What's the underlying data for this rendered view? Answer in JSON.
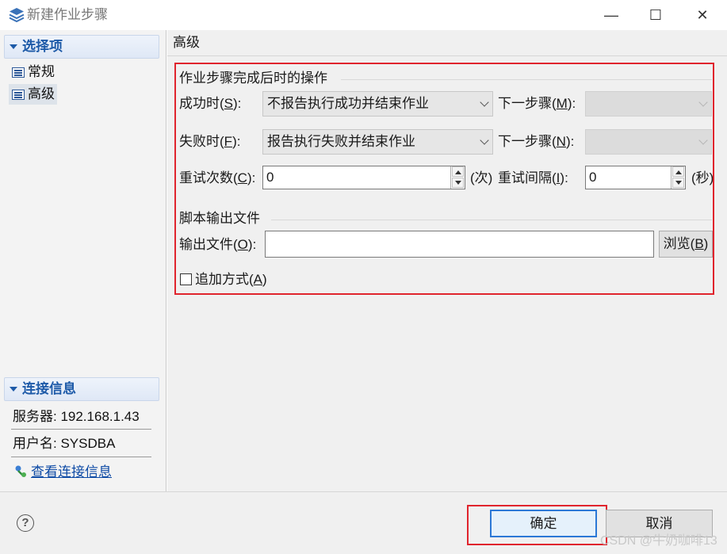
{
  "window": {
    "title": "新建作业步骤",
    "minimize_glyph": "—",
    "maximize_glyph": "☐",
    "close_glyph": "✕"
  },
  "sidebar": {
    "options_header": "选择项",
    "items": [
      {
        "label": "常规",
        "selected": false
      },
      {
        "label": "高级",
        "selected": true
      }
    ],
    "connection_header": "连接信息",
    "server": "服务器: 192.168.1.43",
    "user": "用户名: SYSDBA",
    "view_connection_link": "查看连接信息"
  },
  "main": {
    "header_title": "高级",
    "completion_group": {
      "title": "作业步骤完成后时的操作",
      "success_label": "成功时(",
      "success_key": "S",
      "success_value": "不报告执行成功并结束作业",
      "success_next_label": "下一步骤(",
      "success_next_key": "M",
      "success_next_value": "",
      "failure_label": "失败时(",
      "failure_key": "F",
      "failure_value": "报告执行失败并结束作业",
      "failure_next_label": "下一步骤(",
      "failure_next_key": "N",
      "failure_next_value": "",
      "retry_count_label": "重试次数(",
      "retry_count_key": "C",
      "retry_count_value": "0",
      "retry_count_unit": "(次)",
      "retry_interval_label": "重试间隔(",
      "retry_interval_key": "I",
      "retry_interval_value": "0",
      "retry_interval_unit": "(秒)"
    },
    "output_group": {
      "title": "脚本输出文件",
      "output_file_label": "输出文件(",
      "output_file_key": "O",
      "output_file_value": "",
      "browse_label": "浏览(",
      "browse_key": "B",
      "append_label": "追加方式(",
      "append_key": "A",
      "append_checked": false
    },
    "close_paren": "):",
    "close_paren_plain": ")"
  },
  "footer": {
    "help_glyph": "?",
    "ok_label": "确定",
    "cancel_label": "取消"
  },
  "watermark": "CSDN @牛奶咖啡13",
  "colors": {
    "highlight": "#e0242d",
    "header_text": "#1d5aa8",
    "link": "#0d4aa5",
    "focus": "#2b78d6"
  }
}
